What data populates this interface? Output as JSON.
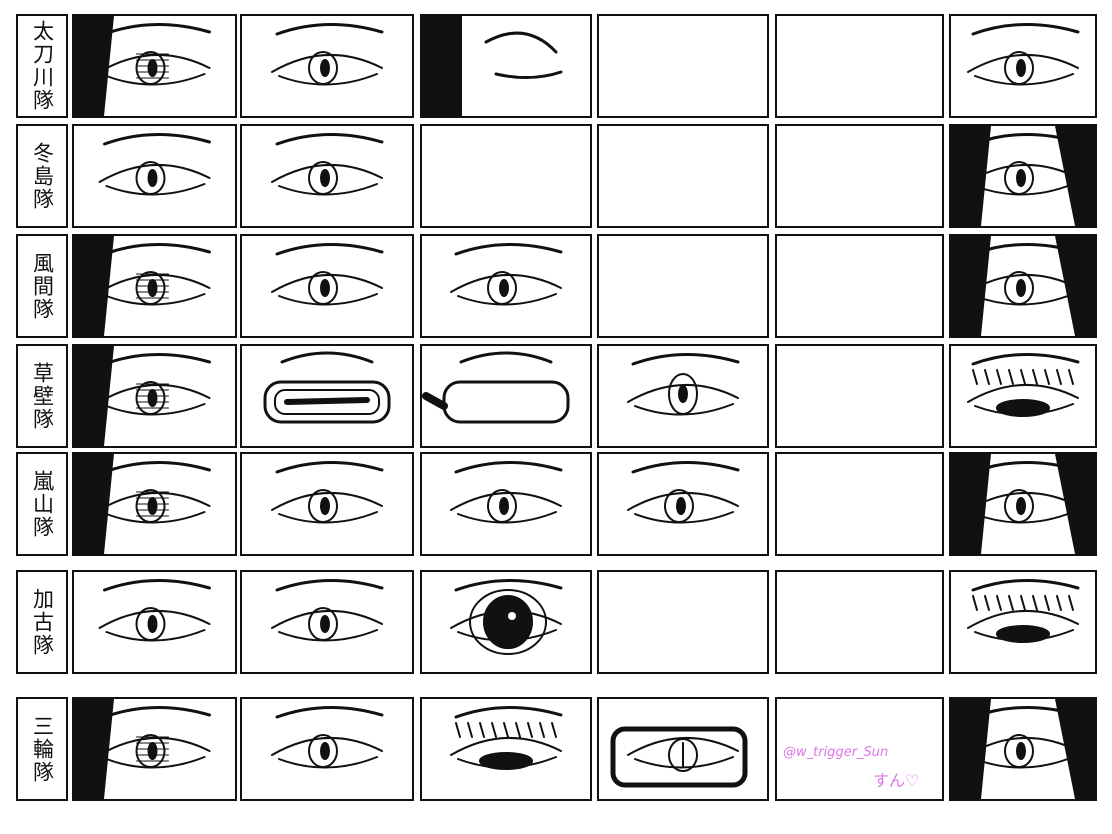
{
  "sheet": {
    "rows": [
      {
        "label": "太刀川隊",
        "cells": [
          "hatched-eye",
          "side-eye",
          "closed-eye",
          "blank",
          "blank",
          "small-eye"
        ]
      },
      {
        "label": "冬島隊",
        "cells": [
          "eye",
          "eye",
          "blank",
          "blank",
          "blank",
          "dark-hair-eye"
        ]
      },
      {
        "label": "風間隊",
        "cells": [
          "hatched-eye",
          "side-eye",
          "eye",
          "blank",
          "blank",
          "dark-hair-eye"
        ]
      },
      {
        "label": "草壁隊",
        "cells": [
          "hatched-eye",
          "goggles",
          "visor",
          "round-eye",
          "blank",
          "lashes-eye"
        ]
      },
      {
        "label": "嵐山隊",
        "cells": [
          "hatched-eye",
          "eye",
          "eye",
          "eye",
          "blank",
          "dark-hair-eye"
        ]
      },
      {
        "label": "加古隊",
        "cells": [
          "eye",
          "side-eye",
          "big-eye",
          "blank",
          "blank",
          "lashes-eye"
        ]
      },
      {
        "label": "三輪隊",
        "cells": [
          "hatched-eye",
          "side-eye",
          "lashes-eye",
          "glasses",
          "signature",
          "dark-hair-eye"
        ]
      }
    ],
    "signature": {
      "handle": "@w_trigger_Sun",
      "note": "すん♡"
    },
    "colors": {
      "ink": "#111111",
      "signature": "#e074e6"
    }
  }
}
